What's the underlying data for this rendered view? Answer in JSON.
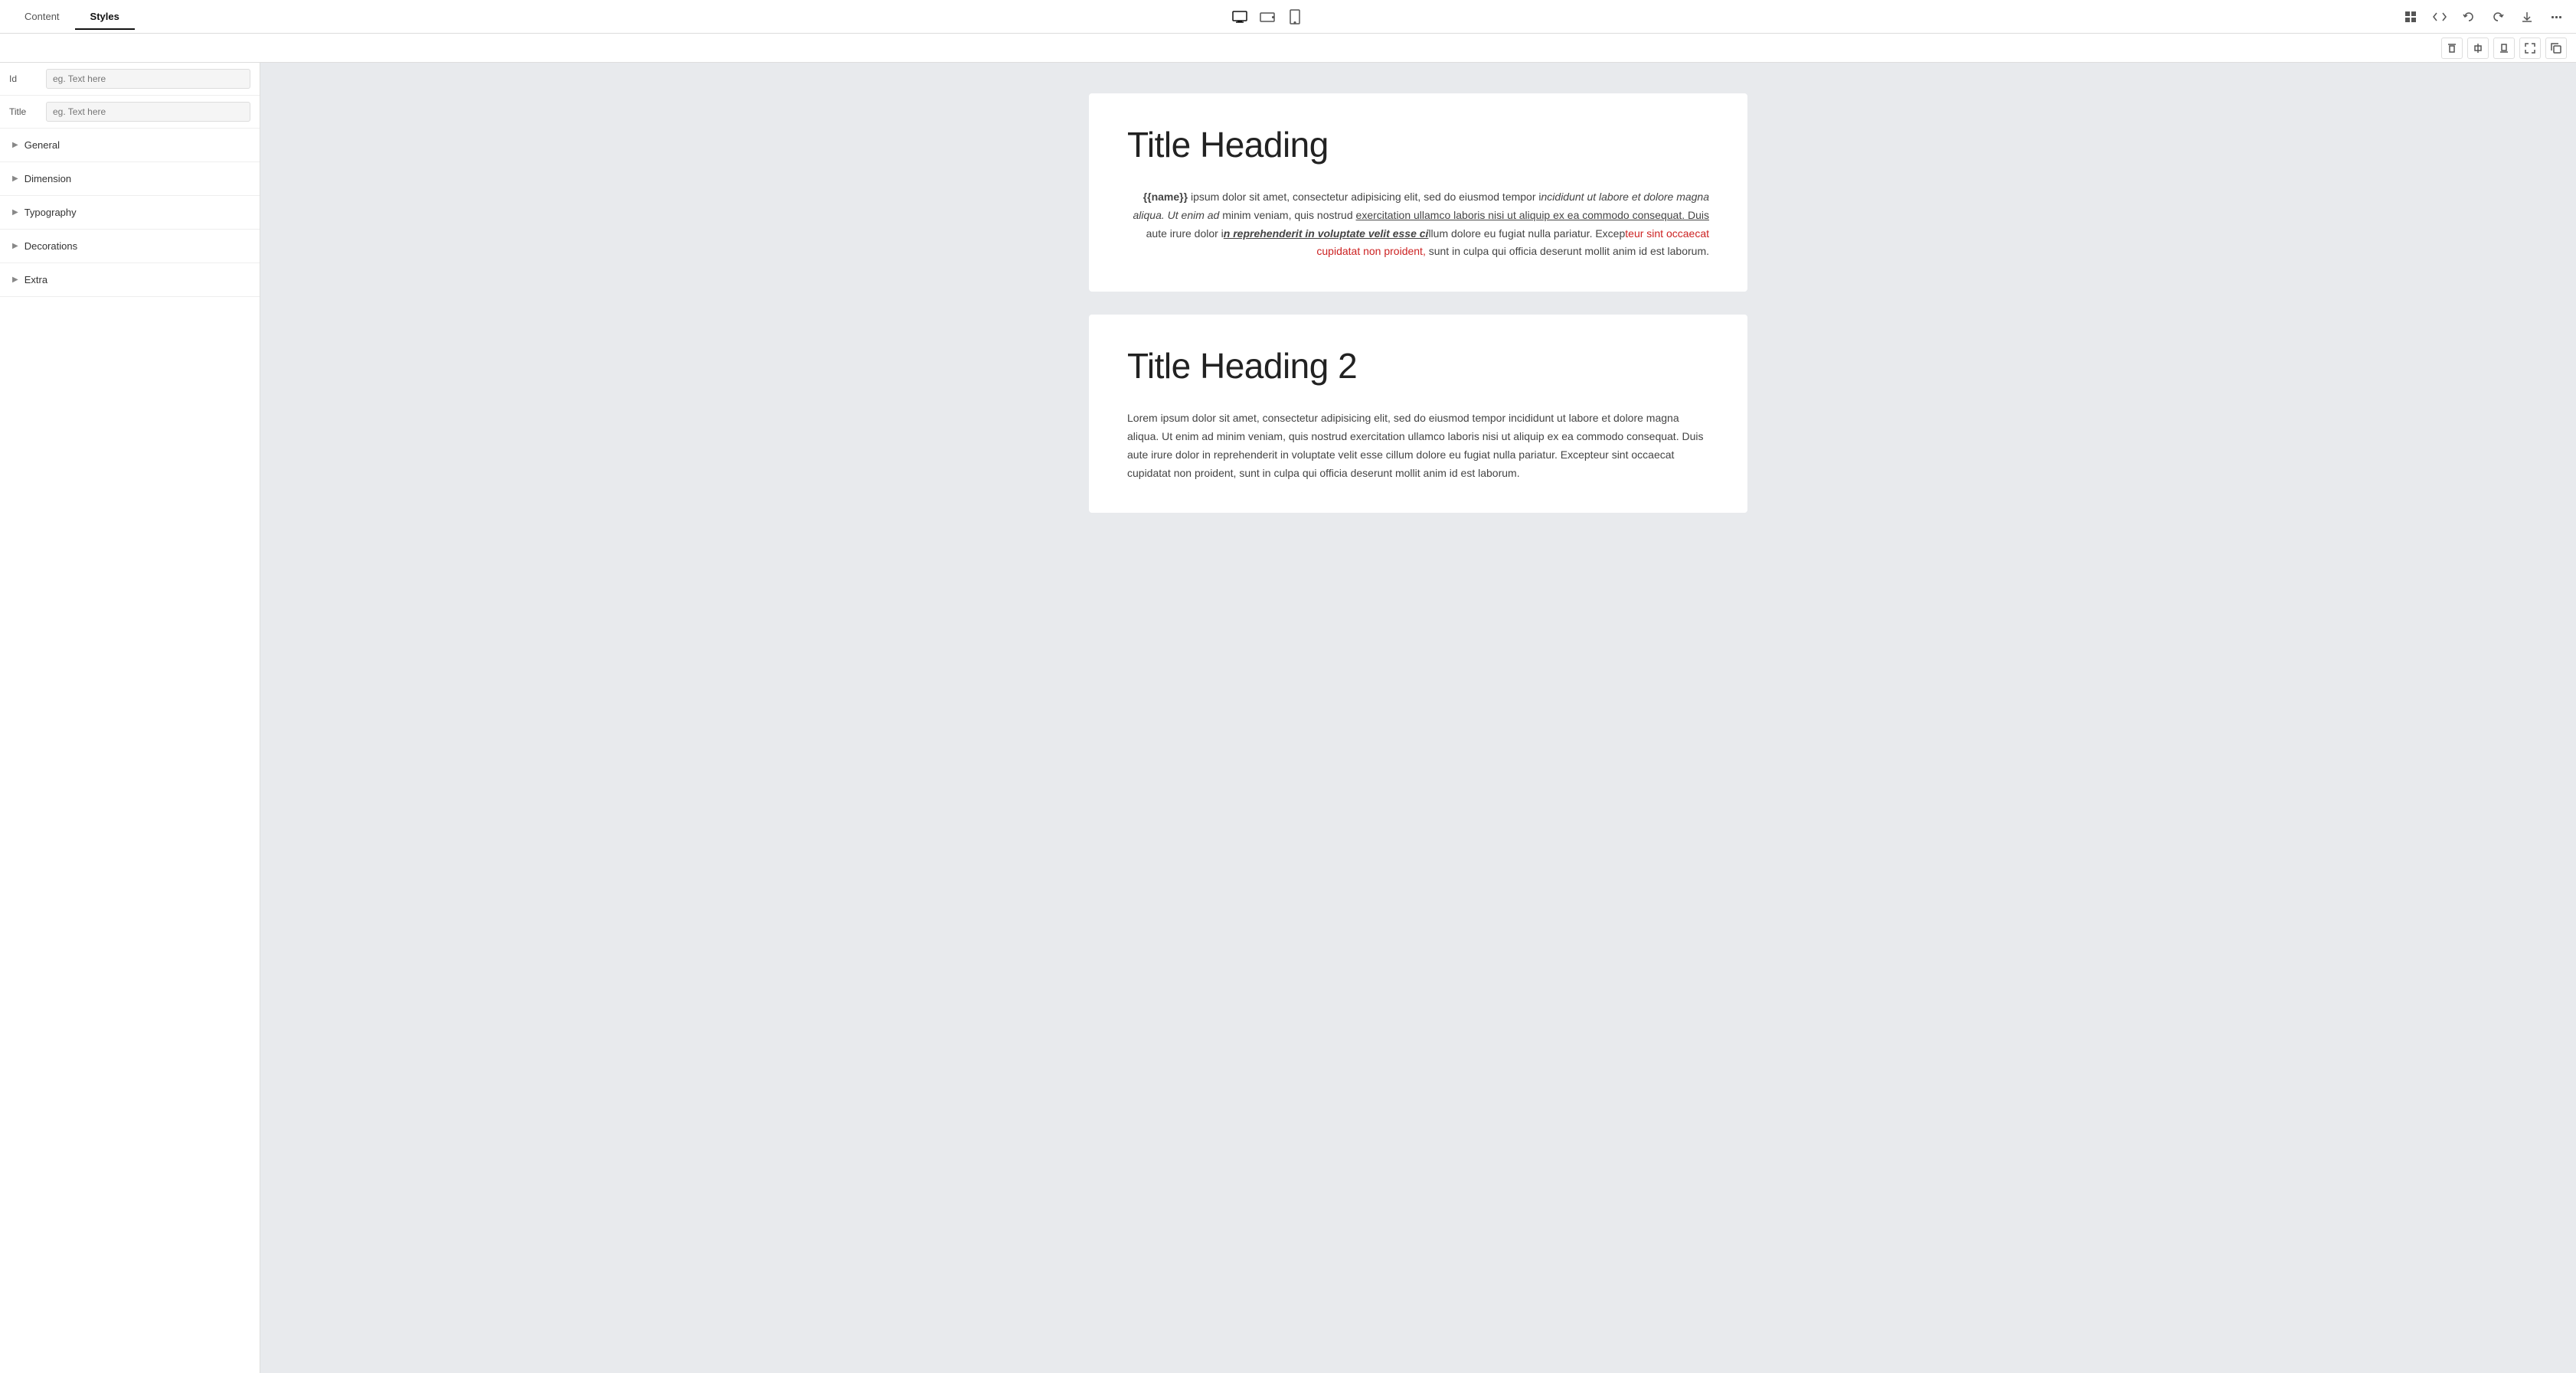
{
  "toolbar": {
    "tabs": [
      {
        "id": "content",
        "label": "Content",
        "active": false
      },
      {
        "id": "styles",
        "label": "Styles",
        "active": true
      }
    ],
    "devices": [
      {
        "id": "desktop",
        "label": "Desktop",
        "active": true
      },
      {
        "id": "tablet-landscape",
        "label": "Tablet Landscape",
        "active": false
      },
      {
        "id": "tablet-portrait",
        "label": "Tablet Portrait",
        "active": false
      }
    ],
    "right_icons": [
      "grid-icon",
      "code-icon",
      "undo-icon",
      "redo-icon",
      "download-icon",
      "more-icon"
    ]
  },
  "toolbar2": {
    "buttons": [
      "align-top-icon",
      "align-center-h-icon",
      "align-bottom-icon",
      "align-left-icon",
      "expand-icon"
    ]
  },
  "left_panel": {
    "id_field": {
      "label": "Id",
      "placeholder": "eg. Text here"
    },
    "title_field": {
      "label": "Title",
      "placeholder": "eg. Text here"
    },
    "sections": [
      {
        "id": "general",
        "label": "General"
      },
      {
        "id": "dimension",
        "label": "Dimension"
      },
      {
        "id": "typography",
        "label": "Typography"
      },
      {
        "id": "decorations",
        "label": "Decorations"
      },
      {
        "id": "extra",
        "label": "Extra"
      }
    ]
  },
  "content": {
    "card1": {
      "title": "Title Heading",
      "body_parts": [
        {
          "text": "{{name}}",
          "style": "bold"
        },
        {
          "text": " ipsum dolor sit amet, consectetur adipisicing elit, sed do eiusmod tempor i",
          "style": "normal"
        },
        {
          "text": "ncididunt ut labore et dolore magna aliqua. Ut enim ad",
          "style": "italic"
        },
        {
          "text": " minim veniam, quis nostrud ",
          "style": "normal"
        },
        {
          "text": "exercitation ullamco laboris nisi ut aliquip ex ea commodo consequat. Duis",
          "style": "underline"
        },
        {
          "text": " aute irure dolor i",
          "style": "normal"
        },
        {
          "text": "n reprehenderit in voluptate velit esse ci",
          "style": "bold-italic-underline"
        },
        {
          "text": "llum dolore eu fugiat nulla pariatur. Excep",
          "style": "normal"
        },
        {
          "text": "teur sint occaecat cupidatat non proident,",
          "style": "red"
        },
        {
          "text": " sunt in culpa qui officia deserunt mollit anim id est laborum.",
          "style": "normal"
        }
      ]
    },
    "card2": {
      "title": "Title Heading 2",
      "body": "Lorem ipsum dolor sit amet, consectetur adipisicing elit, sed do eiusmod tempor incididunt ut labore et dolore magna aliqua. Ut enim ad minim veniam, quis nostrud exercitation ullamco laboris nisi ut aliquip ex ea commodo consequat. Duis aute irure dolor in reprehenderit in voluptate velit esse cillum dolore eu fugiat nulla pariatur. Excepteur sint occaecat cupidatat non proident, sunt in culpa qui officia deserunt mollit anim id est laborum."
    }
  }
}
